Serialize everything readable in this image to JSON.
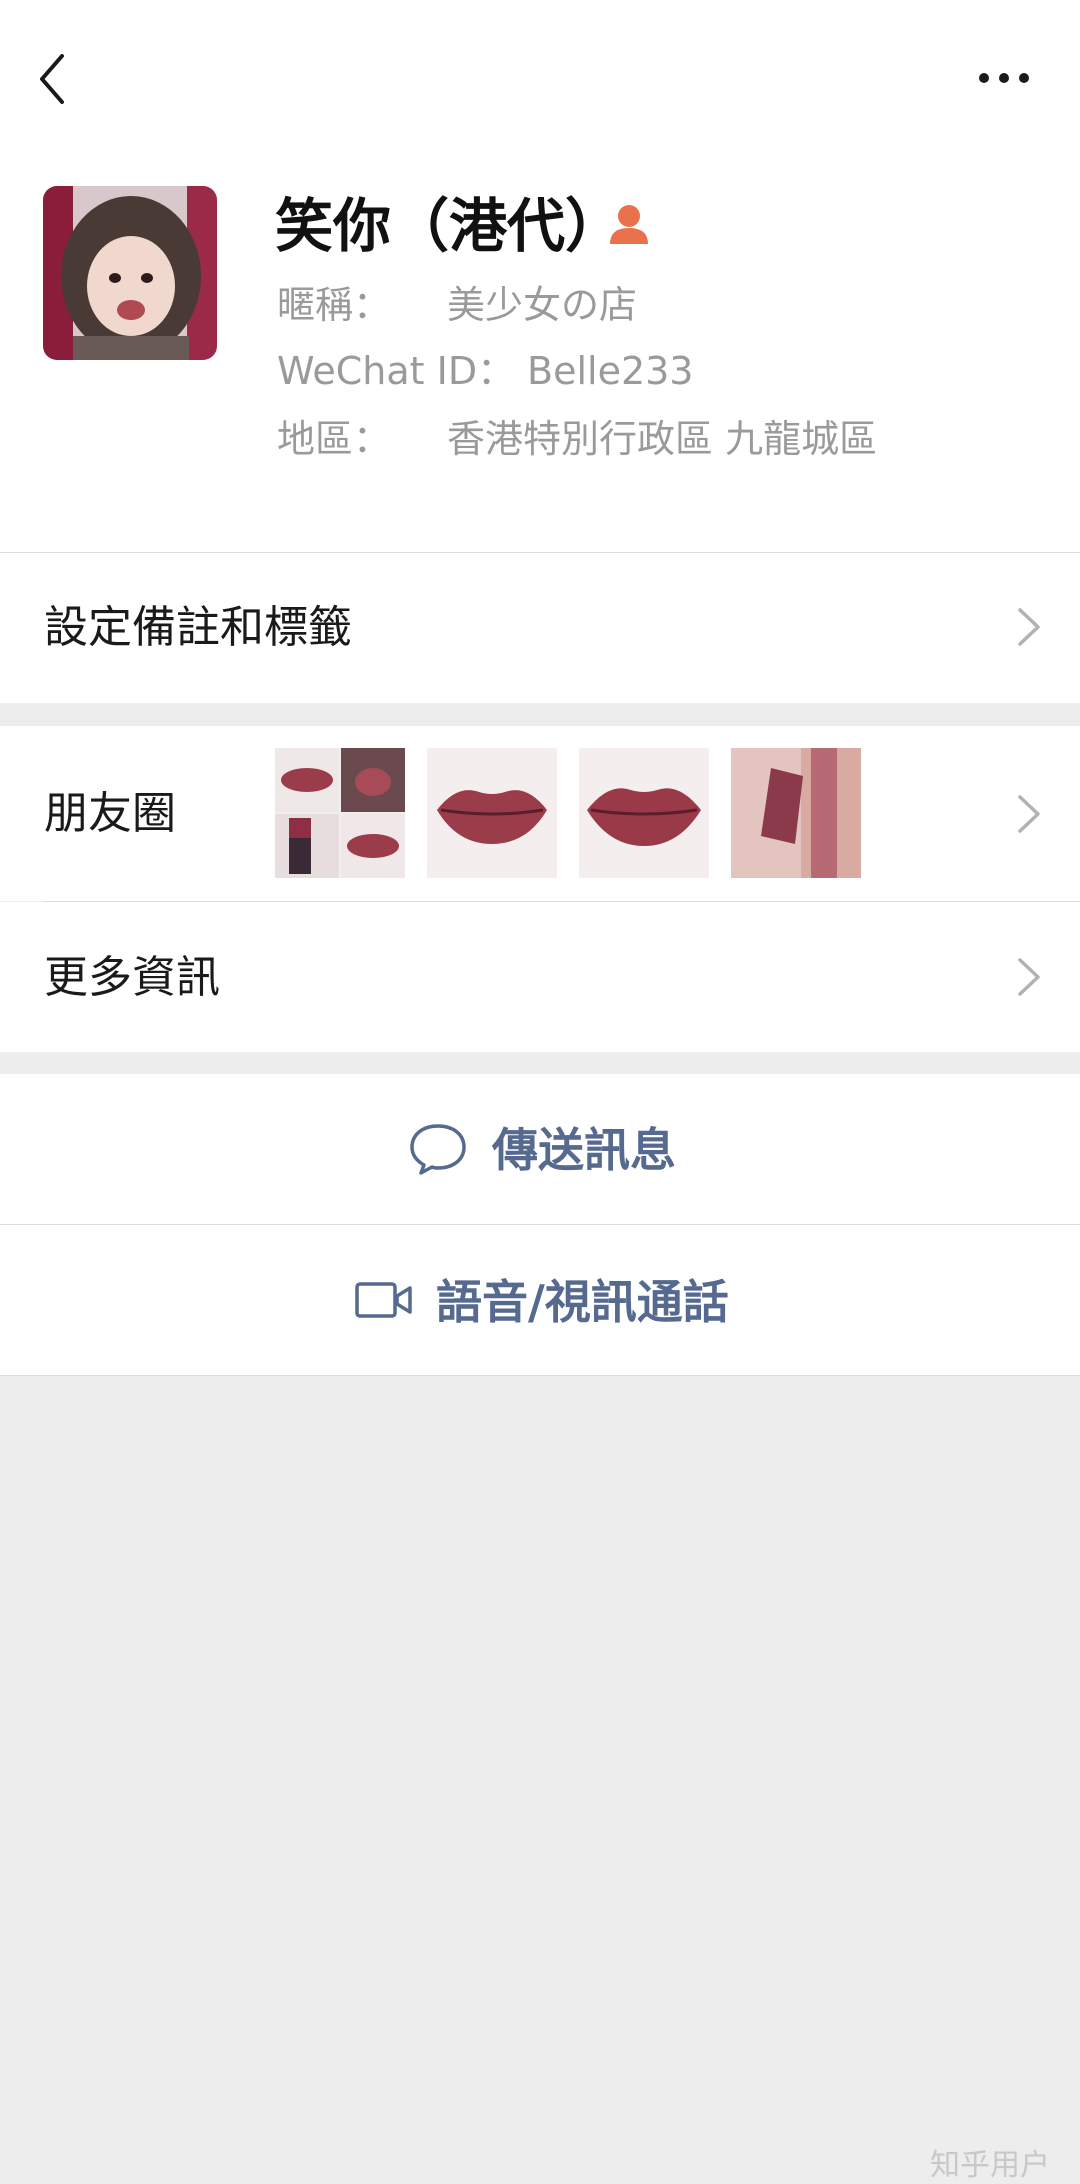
{
  "header": {
    "back_icon": "chevron-left-icon",
    "more_icon": "more-dots-icon"
  },
  "profile": {
    "name": "笑你（港代）",
    "badge_icon": "person-icon",
    "nickname_label": "暱稱：",
    "nickname_value": "美少女の店",
    "wechat_id_label": "WeChat ID：",
    "wechat_id_value": "Belle233",
    "region_label": "地區：",
    "region_value": "香港特別行政區  九龍城區"
  },
  "menu": {
    "remarks_label": "設定備註和標籤",
    "moments_label": "朋友圈",
    "more_info_label": "更多資訊"
  },
  "actions": {
    "message_label": "傳送訊息",
    "message_icon": "chat-bubble-icon",
    "call_label": "語音/視訊通話",
    "call_icon": "video-camera-icon"
  },
  "colors": {
    "action_text": "#56698f",
    "badge": "#e9724c",
    "lip": "#9b3c4b"
  },
  "watermark": "知乎用户"
}
